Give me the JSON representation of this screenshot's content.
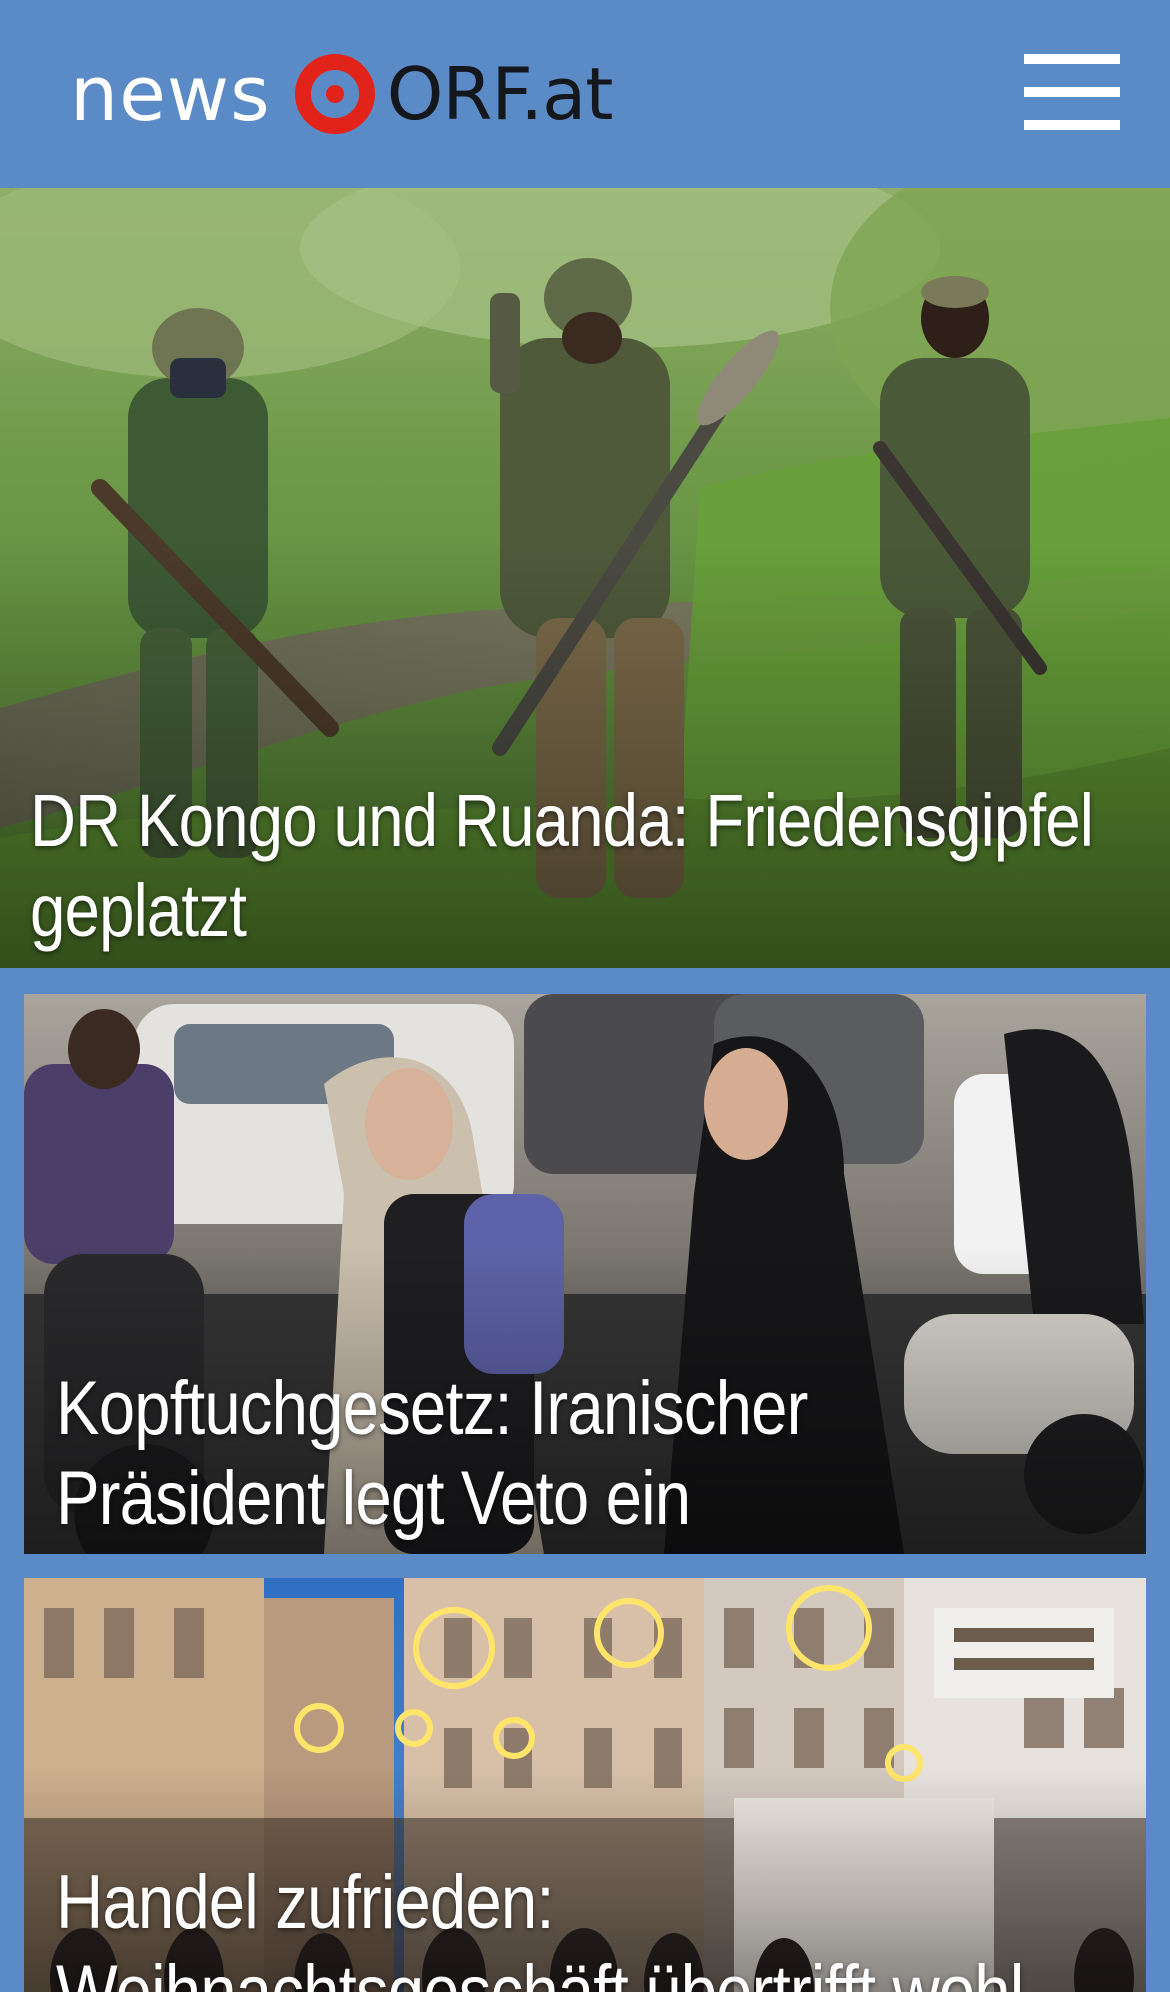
{
  "header": {
    "logo_news": "news",
    "logo_orf": "ORF.at",
    "brand_color": "#5b8bc6",
    "logo_ring_color": "#e2231a",
    "menu_icon": "hamburger-menu-icon"
  },
  "stories": [
    {
      "headline_line1": "DR Kongo und Ruanda: Friedensgipfel",
      "headline_line2": "geplatzt"
    },
    {
      "headline_line1": "Kopftuchgesetz: Iranischer",
      "headline_line2": "Präsident legt Veto ein"
    },
    {
      "headline_line1": "Handel zufrieden:",
      "headline_line2": "Weihnachtsgeschäft übertrifft wohl"
    }
  ]
}
